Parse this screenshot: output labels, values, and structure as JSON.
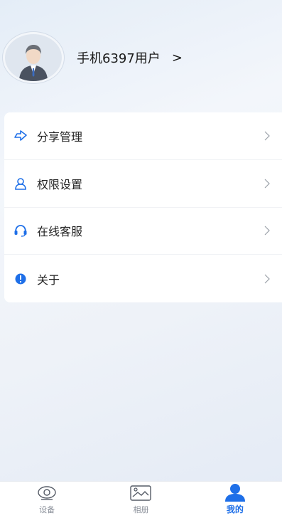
{
  "profile": {
    "username": "手机6397用户",
    "chevron": ">"
  },
  "menu": {
    "items": [
      {
        "label": "分享管理",
        "icon": "share-icon"
      },
      {
        "label": "权限设置",
        "icon": "user-permission-icon"
      },
      {
        "label": "在线客服",
        "icon": "headset-icon"
      },
      {
        "label": "关于",
        "icon": "info-icon"
      }
    ]
  },
  "tabbar": {
    "tabs": [
      {
        "label": "设备",
        "icon": "camera-device-icon",
        "active": false
      },
      {
        "label": "相册",
        "icon": "album-icon",
        "active": false
      },
      {
        "label": "我的",
        "icon": "person-icon",
        "active": true
      }
    ]
  },
  "colors": {
    "accent": "#1e6fe8",
    "text": "#222222",
    "muted": "#8a8f99"
  }
}
